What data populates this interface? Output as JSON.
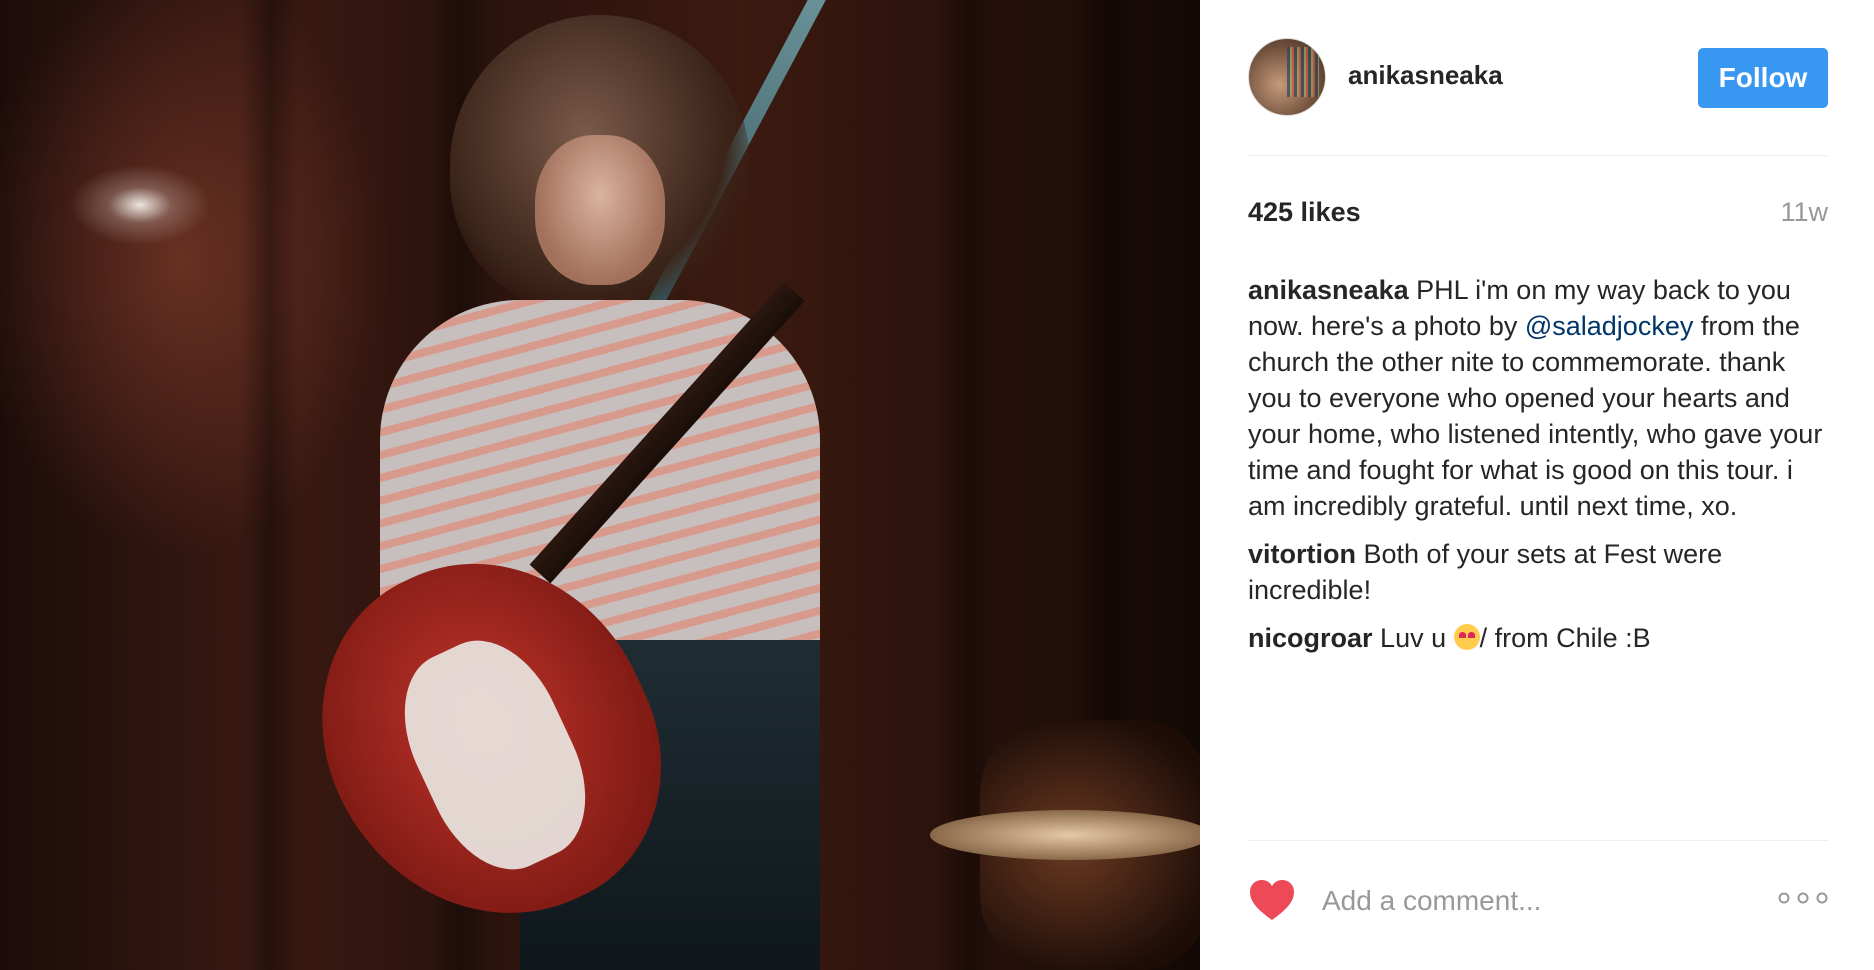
{
  "post": {
    "username": "anikasneaka",
    "follow_label": "Follow",
    "likes": "425 likes",
    "time_ago": "11w",
    "caption": {
      "author": "anikasneaka",
      "text_before": "PHL i'm on my way back to you now. here's a photo by ",
      "mention": "@saladjockey",
      "text_after": " from the church the other nite to commemorate. thank you to everyone who opened your hearts and your home, who listened intently, who gave your time and fought for what is good on this tour. i am incredibly grateful. until next time, xo."
    },
    "comments": [
      {
        "author": "vitortion",
        "text": "Both of your sets at Fest were incredible!"
      },
      {
        "author": "nicogroar",
        "text_before": "Luv u ",
        "text_after": "/ from Chile :B"
      }
    ],
    "add_comment_placeholder": "Add a comment...",
    "icons": {
      "like": "heart-icon",
      "more": "more-options-icon"
    },
    "colors": {
      "follow_button": "#3897f0",
      "heart": "#ed4956",
      "mention": "#003569",
      "muted_text": "#999999"
    }
  }
}
